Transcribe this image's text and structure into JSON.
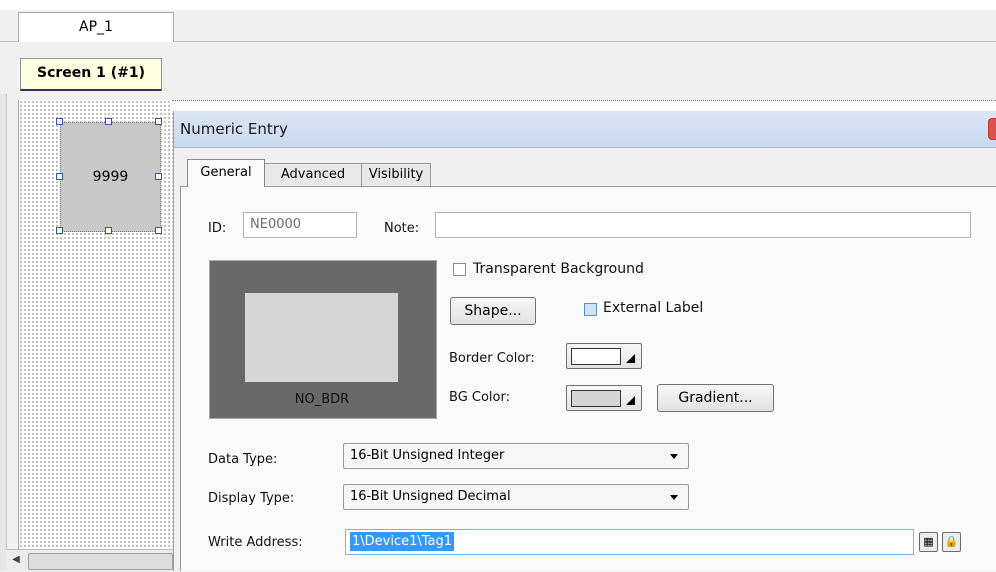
{
  "project_tab": "AP_1",
  "screen_tab": "Screen 1 (#1)",
  "canvas": {
    "widget_value": "9999"
  },
  "dialog": {
    "title": "Numeric Entry",
    "tabs": [
      "General",
      "Advanced",
      "Visibility"
    ],
    "active_tab": "General",
    "id_label": "ID:",
    "id_value": "NE0000",
    "note_label": "Note:",
    "note_value": "",
    "preview_caption": "NO_BDR",
    "transparent_bg_label": "Transparent Background",
    "shape_button": "Shape...",
    "external_label_label": "External Label",
    "border_color_label": "Border Color:",
    "border_color": "#ffffff",
    "bg_color_label": "BG Color:",
    "bg_color": "#d4d4d4",
    "gradient_button": "Gradient...",
    "data_type_label": "Data Type:",
    "data_type_value": "16-Bit Unsigned Integer",
    "display_type_label": "Display Type:",
    "display_type_value": "16-Bit Unsigned Decimal",
    "write_address_label": "Write Address:",
    "write_address_value": "1\\Device1\\Tag1"
  },
  "icons": {
    "address_browse": "keypad-icon",
    "address_lock": "lock-icon"
  }
}
